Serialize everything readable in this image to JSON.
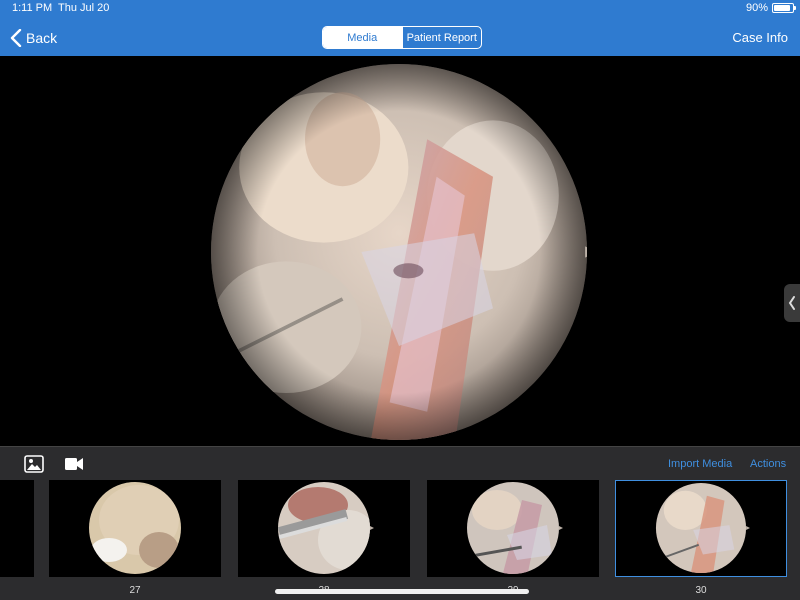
{
  "status_bar": {
    "time": "1:11 PM",
    "date": "Thu Jul 20",
    "battery_percent": "90%",
    "battery_level": 0.9
  },
  "nav": {
    "back_label": "Back",
    "back_icon": "chevron-left-icon",
    "segments": [
      {
        "label": "Media",
        "active": true
      },
      {
        "label": "Patient Report",
        "active": false
      }
    ],
    "right_label": "Case Info"
  },
  "viewer": {
    "handle_icon": "chevron-left-icon"
  },
  "media_panel": {
    "tabs": [
      {
        "icon": "photo-icon",
        "active": true
      },
      {
        "icon": "video-camera-icon",
        "active": false
      }
    ],
    "import_label": "Import Media",
    "actions_label": "Actions",
    "thumbnails": [
      {
        "label": "27",
        "selected": false
      },
      {
        "label": "28",
        "selected": false
      },
      {
        "label": "29",
        "selected": false
      },
      {
        "label": "30",
        "selected": true
      }
    ]
  },
  "colors": {
    "accent": "#2f7bd0",
    "link": "#3f8fe0",
    "panel": "#2c2c2e"
  }
}
